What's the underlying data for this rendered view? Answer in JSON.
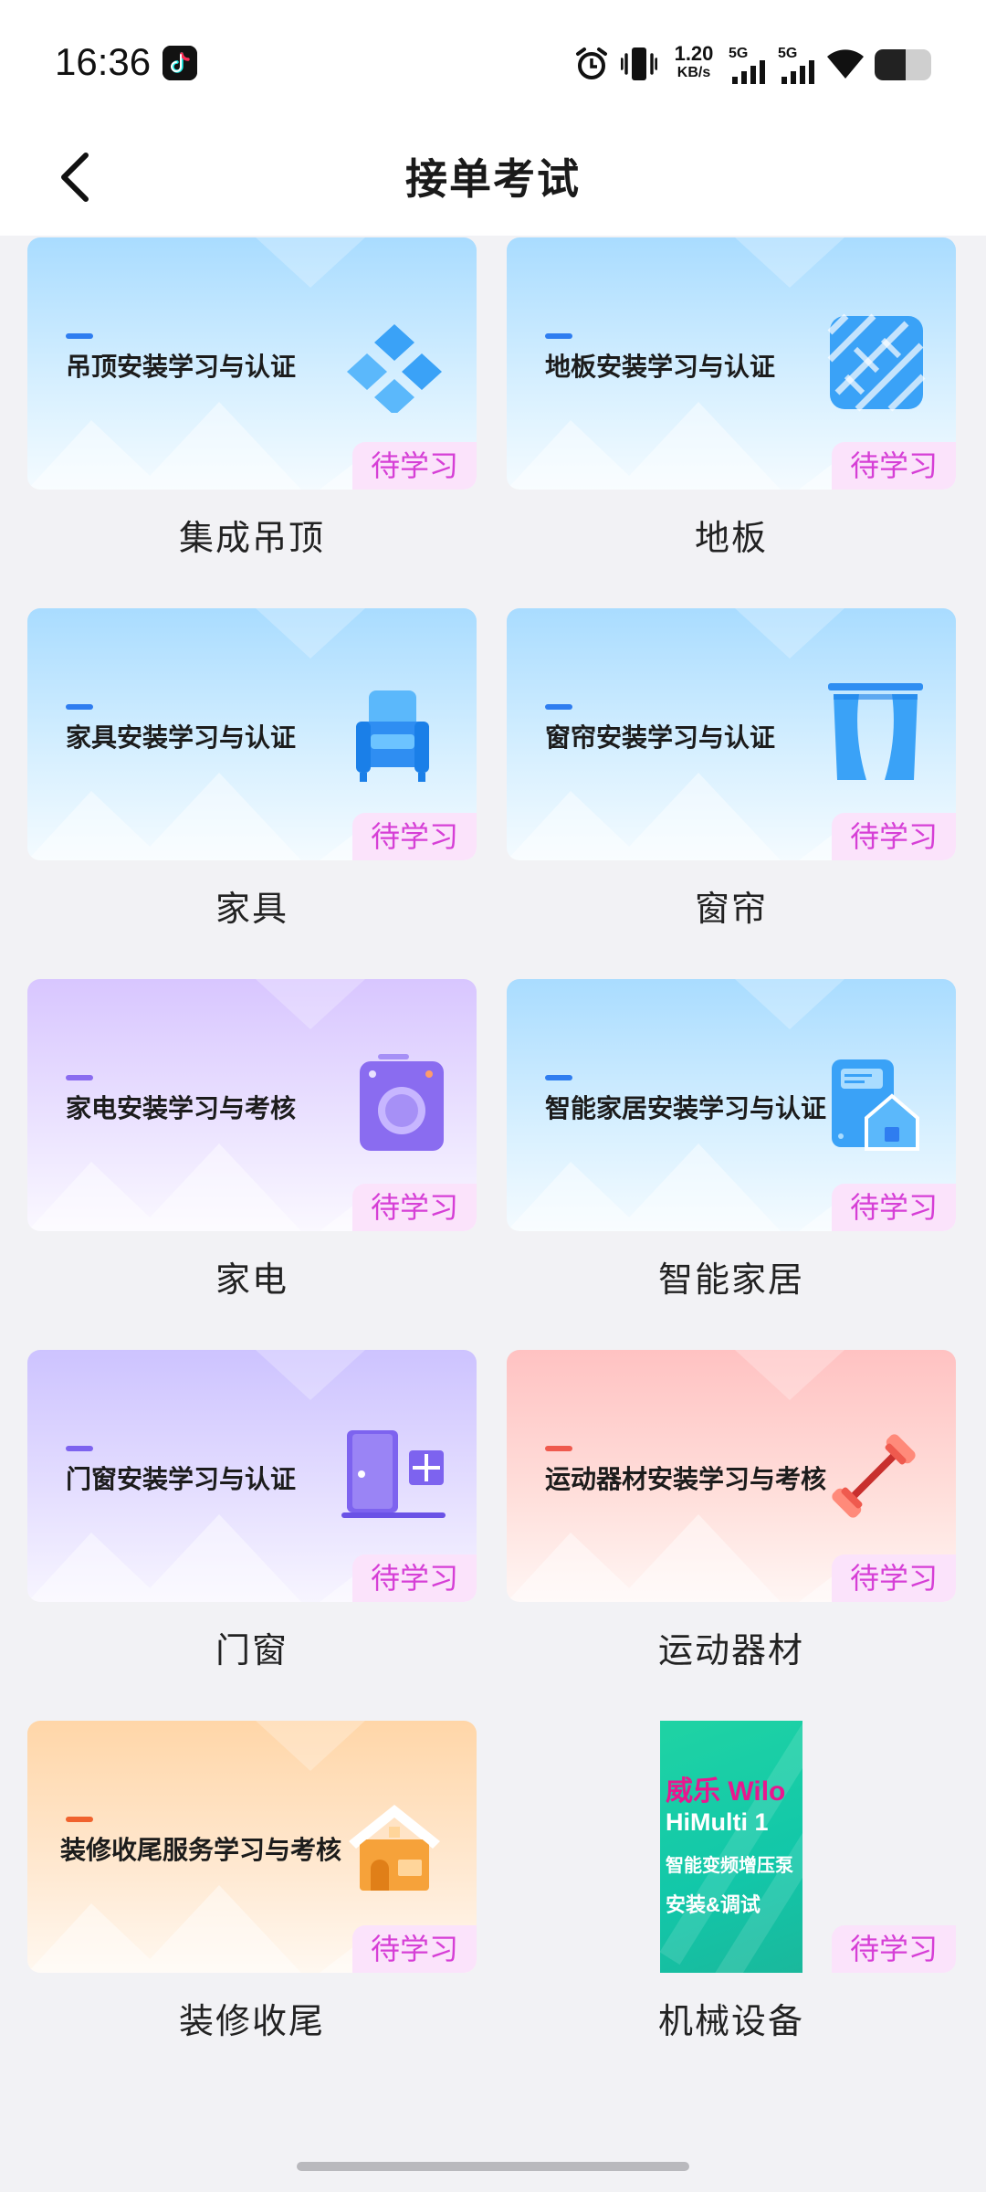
{
  "status_bar": {
    "time": "16:36",
    "net_speed_value": "1.20",
    "net_speed_unit": "KB/s",
    "sim1": "5G",
    "sim2": "5G",
    "battery_level": 0.55
  },
  "header": {
    "title": "接单考试"
  },
  "badge_label": "待学习",
  "cards": [
    {
      "title": "吊顶安装学习与认证",
      "label": "集成吊顶",
      "theme": "blue",
      "icon": "ceiling-tiles-icon",
      "accent": "#2f7df0"
    },
    {
      "title": "地板安装学习与认证",
      "label": "地板",
      "theme": "blue",
      "icon": "floor-planks-icon",
      "accent": "#2f7df0"
    },
    {
      "title": "家具安装学习与认证",
      "label": "家具",
      "theme": "blue",
      "icon": "armchair-icon",
      "accent": "#2f7df0"
    },
    {
      "title": "窗帘安装学习与认证",
      "label": "窗帘",
      "theme": "blue",
      "icon": "curtain-icon",
      "accent": "#2f7df0"
    },
    {
      "title": "家电安装学习与考核",
      "label": "家电",
      "theme": "purple",
      "icon": "washing-machine-icon",
      "accent": "#8a6cf0"
    },
    {
      "title": "智能家居安装学习与认证",
      "label": "智能家居",
      "theme": "blue",
      "icon": "smart-home-icon",
      "accent": "#2f7df0"
    },
    {
      "title": "门窗安装学习与认证",
      "label": "门窗",
      "theme": "purple",
      "icon": "door-window-icon",
      "accent": "#7d63ef"
    },
    {
      "title": "运动器材安装学习与考核",
      "label": "运动器材",
      "theme": "pink",
      "icon": "dumbbell-icon",
      "accent": "#ef5a4e"
    },
    {
      "title": "装修收尾服务学习与考核",
      "label": "装修收尾",
      "theme": "orange",
      "icon": "house-icon",
      "accent": "#f0622e"
    }
  ],
  "product_card": {
    "label": "机械设备",
    "image_lines": [
      "威乐 Wilo",
      "HiMulti 1",
      "智能变频增压泵",
      "安装&调试"
    ]
  }
}
